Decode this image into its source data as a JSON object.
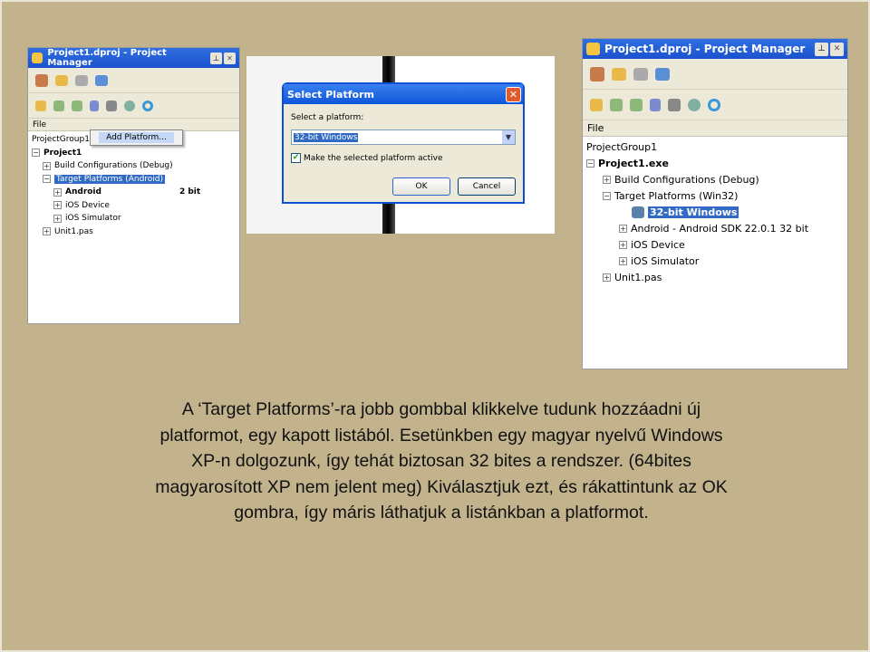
{
  "left_panel": {
    "title": "Project1.dproj - Project Manager",
    "header": "File",
    "tree": [
      "ProjectGroup1",
      "Project1",
      "Build Configurations (Debug)",
      "Target Platforms (Android)",
      "Android",
      "iOS Device",
      "iOS Simulator",
      "Unit1.pas"
    ],
    "android_suffix": "2 bit",
    "context_menu_item": "Add Platform..."
  },
  "dialog": {
    "title": "Select Platform",
    "label": "Select a platform:",
    "combo_value": "32-bit Windows",
    "checkbox_label": "Make the selected platform active",
    "checked": true,
    "ok": "OK",
    "cancel": "Cancel"
  },
  "right_panel": {
    "title": "Project1.dproj - Project Manager",
    "header": "File",
    "tree": [
      "ProjectGroup1",
      "Project1.exe",
      "Build Configurations (Debug)",
      "Target Platforms (Win32)",
      "32-bit Windows",
      "Android - Android SDK 22.0.1 32 bit",
      "iOS Device",
      "iOS Simulator",
      "Unit1.pas"
    ]
  },
  "caption": [
    "A ‘Target Platforms’-ra jobb gombbal klikkelve tudunk hozzáadni új",
    "platformot, egy kapott listából. Esetünkben egy magyar nyelvű Windows",
    "XP-n dolgozunk, így tehát biztosan 32 bites a rendszer. (64bites",
    "magyarosított XP nem jelent meg) Kiválasztjuk ezt, és rákattintunk az OK",
    "gombra, így máris láthatjuk a listánkban a platformot."
  ],
  "colors": {
    "background": "#c2b38d",
    "titlebar": "#1c52cf",
    "selection": "#316ac5"
  }
}
